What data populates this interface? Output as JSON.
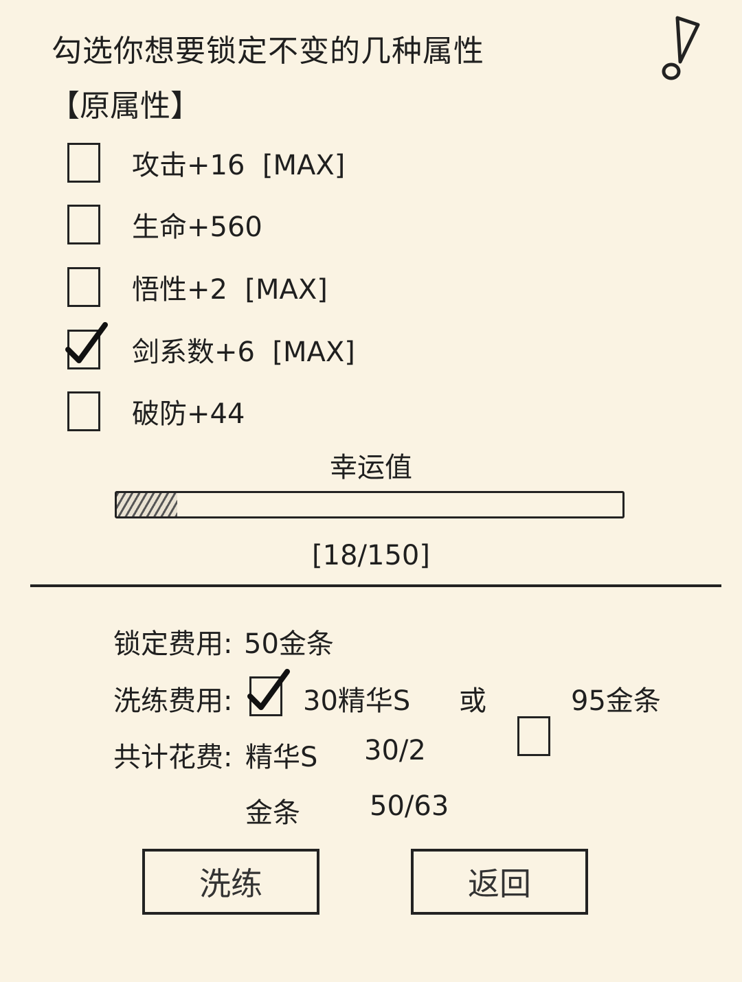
{
  "title": "勾选你想要锁定不变的几种属性",
  "section_heading": "【原属性】",
  "attributes": [
    {
      "label": "攻击+16  [MAX]",
      "checked": false
    },
    {
      "label": "生命+560",
      "checked": false
    },
    {
      "label": "悟性+2  [MAX]",
      "checked": false
    },
    {
      "label": "剑系数+6  [MAX]",
      "checked": true
    },
    {
      "label": "破防+44",
      "checked": false
    }
  ],
  "luck": {
    "label": "幸运值",
    "value": 18,
    "max": 150,
    "display": "[18/150]"
  },
  "costs": {
    "lock_label": "锁定费用:",
    "lock_value": "50金条",
    "refine_label": "洗练费用:",
    "option_essence": {
      "label": "30精华S",
      "checked": true
    },
    "or_text": "或",
    "option_gold": {
      "label": "95金条",
      "checked": false
    },
    "total_label": "共计花费:",
    "total_essence_name": "精华S",
    "total_essence_value": "30/2",
    "total_gold_name": "金条",
    "total_gold_value": "50/63"
  },
  "buttons": {
    "refine": "洗练",
    "back": "返回"
  },
  "icons": {
    "alert": "exclamation-icon",
    "check": "checkmark-icon"
  }
}
